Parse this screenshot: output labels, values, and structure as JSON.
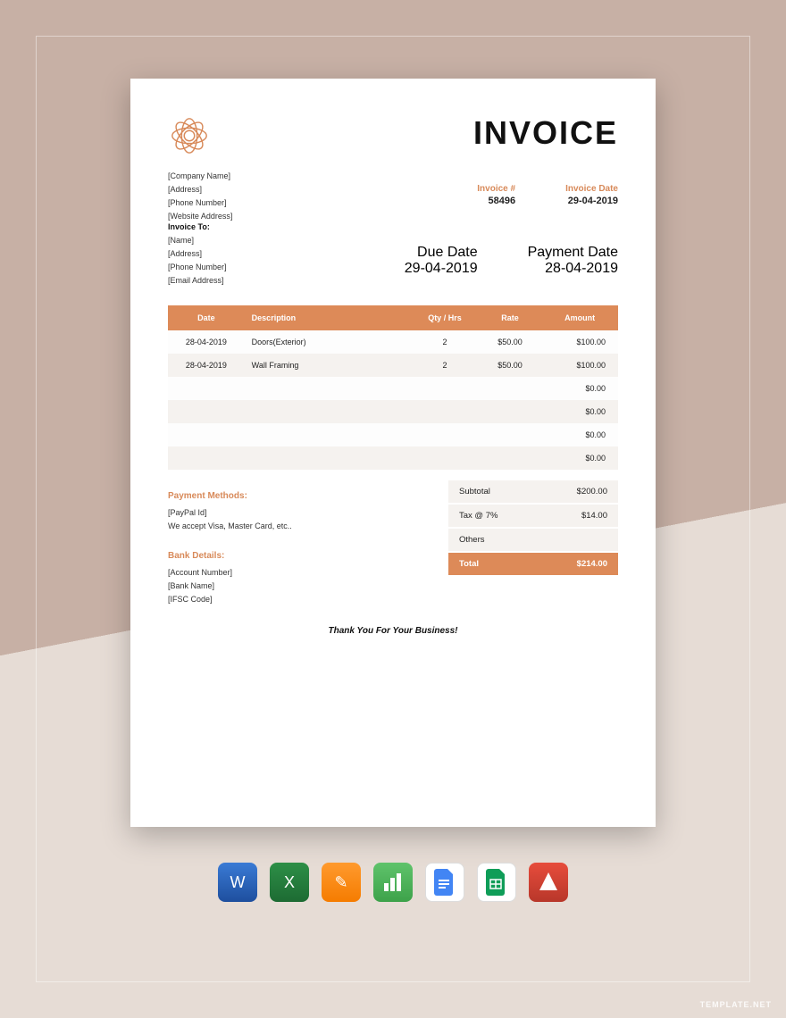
{
  "title": "INVOICE",
  "sender": {
    "company": "[Company Name]",
    "address": "[Address]",
    "phone": "[Phone Number]",
    "website": "[Website Address]"
  },
  "meta": {
    "invoice_num_label": "Invoice #",
    "invoice_num": "58496",
    "invoice_date_label": "Invoice Date",
    "invoice_date": "29-04-2019",
    "due_date_label": "Due Date",
    "due_date": "29-04-2019",
    "payment_date_label": "Payment Date",
    "payment_date": "28-04-2019"
  },
  "bill_to": {
    "header": "Invoice To:",
    "name": "[Name]",
    "address": "[Address]",
    "phone": "[Phone Number]",
    "email": "[Email Address]"
  },
  "columns": {
    "date": "Date",
    "desc": "Description",
    "qty": "Qty / Hrs",
    "rate": "Rate",
    "amount": "Amount"
  },
  "rows": [
    {
      "date": "28-04-2019",
      "desc": "Doors(Exterior)",
      "qty": "2",
      "rate": "$50.00",
      "amount": "$100.00"
    },
    {
      "date": "28-04-2019",
      "desc": "Wall Framing",
      "qty": "2",
      "rate": "$50.00",
      "amount": "$100.00"
    },
    {
      "date": "",
      "desc": "",
      "qty": "",
      "rate": "",
      "amount": "$0.00"
    },
    {
      "date": "",
      "desc": "",
      "qty": "",
      "rate": "",
      "amount": "$0.00"
    },
    {
      "date": "",
      "desc": "",
      "qty": "",
      "rate": "",
      "amount": "$0.00"
    },
    {
      "date": "",
      "desc": "",
      "qty": "",
      "rate": "",
      "amount": "$0.00"
    }
  ],
  "totals": {
    "subtotal_label": "Subtotal",
    "subtotal": "$200.00",
    "tax_label": "Tax @ 7%",
    "tax": "$14.00",
    "others_label": "Others",
    "others": "",
    "total_label": "Total",
    "total": "$214.00"
  },
  "payment": {
    "header": "Payment Methods:",
    "paypal": "[PayPal Id]",
    "note": "We accept Visa, Master Card, etc.."
  },
  "bank": {
    "header": "Bank Details:",
    "account": "[Account Number]",
    "name": "[Bank Name]",
    "ifsc": "[IFSC Code]"
  },
  "thanks": "Thank You For Your Business!",
  "watermark": "TEMPLATE.NET",
  "apps": {
    "word": "W",
    "excel": "X",
    "pages": "✎",
    "numbers": "▮",
    "gdocs": "≡",
    "gsheets": "▦",
    "pdf": "A"
  }
}
